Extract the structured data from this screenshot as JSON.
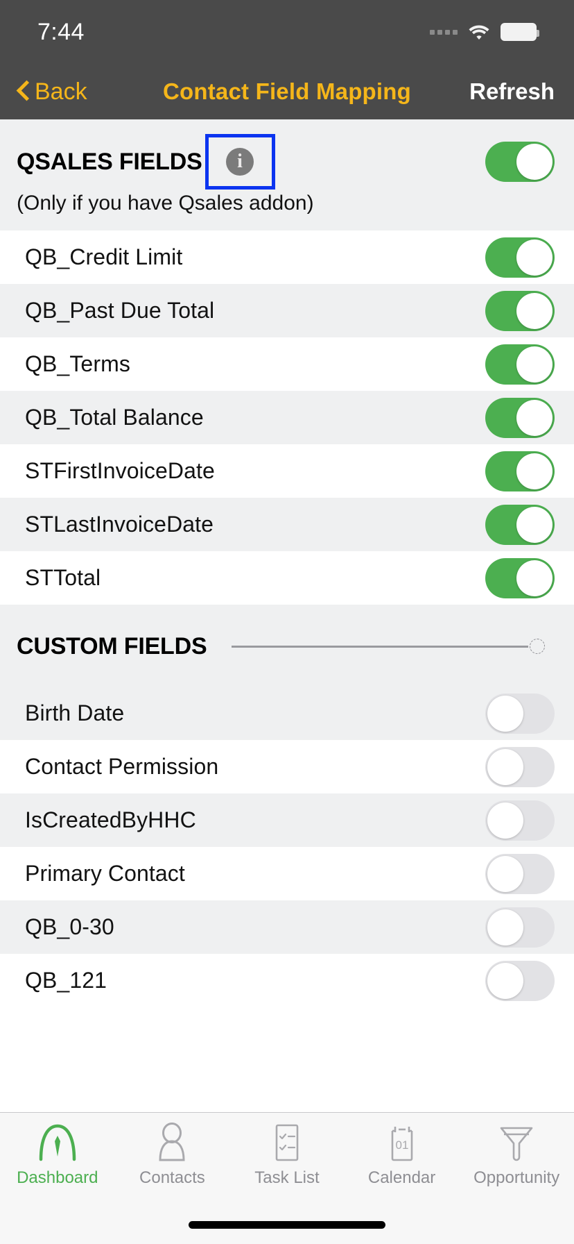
{
  "status_bar": {
    "time": "7:44",
    "signal_icon": "signal-dots-icon",
    "wifi_icon": "wifi-icon",
    "battery_icon": "battery-icon"
  },
  "nav_bar": {
    "back_label": "Back",
    "back_icon": "chevron-left-icon",
    "title": "Contact Field Mapping",
    "refresh_label": "Refresh",
    "title_color": "#f5b61a",
    "background_color": "#4a4a4a"
  },
  "sections": [
    {
      "id": "qsales-fields",
      "title": "QSALES FIELDS",
      "subtitle": "(Only if you have Qsales addon)",
      "info_icon": "info-icon",
      "info_highlighted": true,
      "toggle": "on",
      "rows": [
        {
          "label": "QB_Credit Limit",
          "toggle": "on"
        },
        {
          "label": "QB_Past Due Total",
          "toggle": "on"
        },
        {
          "label": "QB_Terms",
          "toggle": "on"
        },
        {
          "label": "QB_Total Balance",
          "toggle": "on"
        },
        {
          "label": "STFirstInvoiceDate",
          "toggle": "on"
        },
        {
          "label": "STLastInvoiceDate",
          "toggle": "on"
        },
        {
          "label": "STTotal",
          "toggle": "on"
        }
      ]
    },
    {
      "id": "custom-fields",
      "title": "CUSTOM FIELDS",
      "has_slider": true,
      "rows": [
        {
          "label": "Birth Date",
          "toggle": "off"
        },
        {
          "label": "Contact Permission",
          "toggle": "off"
        },
        {
          "label": "IsCreatedByHHC",
          "toggle": "off"
        },
        {
          "label": "Primary Contact",
          "toggle": "off"
        },
        {
          "label": "QB_0-30",
          "toggle": "off"
        },
        {
          "label": "QB_121",
          "toggle": "off"
        }
      ]
    }
  ],
  "tab_bar": {
    "active": "Dashboard",
    "items": [
      {
        "label": "Dashboard",
        "icon": "gauge-icon",
        "active": true
      },
      {
        "label": "Contacts",
        "icon": "person-icon",
        "active": false
      },
      {
        "label": "Task List",
        "icon": "checklist-icon",
        "active": false
      },
      {
        "label": "Calendar",
        "icon": "calendar-icon",
        "active": false,
        "icon_text": "01"
      },
      {
        "label": "Opportunity",
        "icon": "funnel-icon",
        "active": false
      }
    ]
  },
  "colors": {
    "toggle_on": "#4caf50",
    "toggle_off": "#e2e2e5",
    "accent_yellow": "#f5b61a",
    "row_alt": "#eff0f1",
    "highlight_box": "#0b34f0"
  }
}
